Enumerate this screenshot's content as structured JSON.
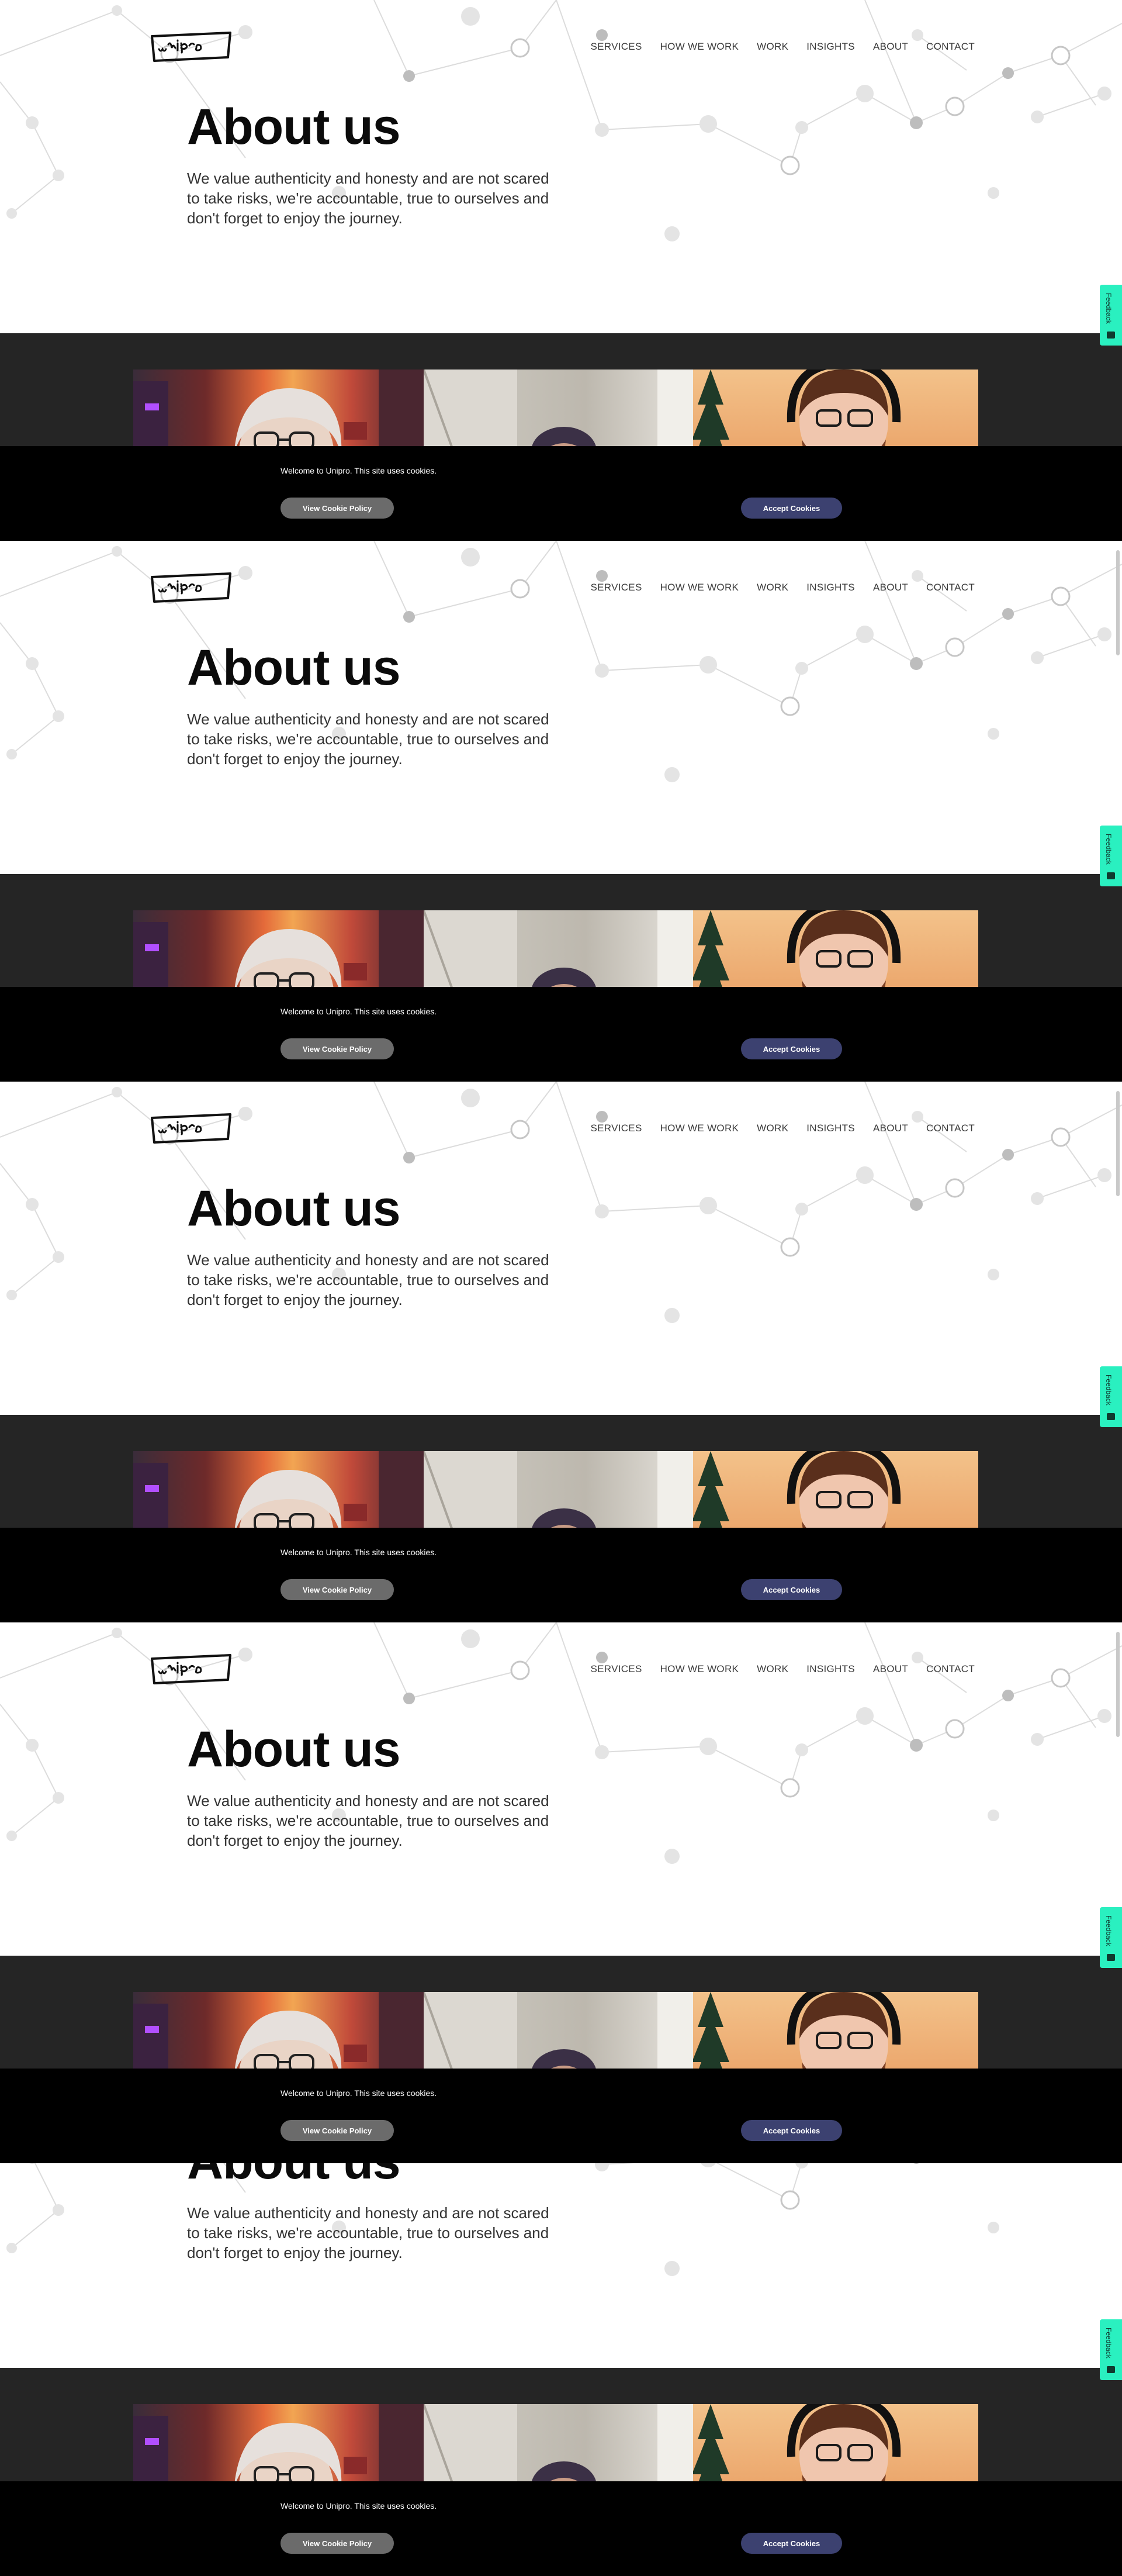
{
  "brand": {
    "name": "Unipro"
  },
  "nav": {
    "items": [
      "SERVICES",
      "HOW WE WORK",
      "WORK",
      "INSIGHTS",
      "ABOUT",
      "CONTACT"
    ]
  },
  "hero": {
    "title": "About us",
    "text": "We value authenticity and honesty and are not scared to take risks, we're accountable, true to ourselves and don't forget to enjoy the journey."
  },
  "feedback": {
    "label": "Feedback",
    "icon": "envelope-icon"
  },
  "cookie": {
    "message": "Welcome to Unipro. This site uses cookies.",
    "policy_label": "View Cookie Policy",
    "accept_label": "Accept Cookies"
  },
  "colors": {
    "background": "#ffffff",
    "dark_band": "#252525",
    "cookie_bar": "#000000",
    "policy_button": "#6b6b6b",
    "accept_button": "#3c4170",
    "feedback_tab": "#2af0c0"
  }
}
